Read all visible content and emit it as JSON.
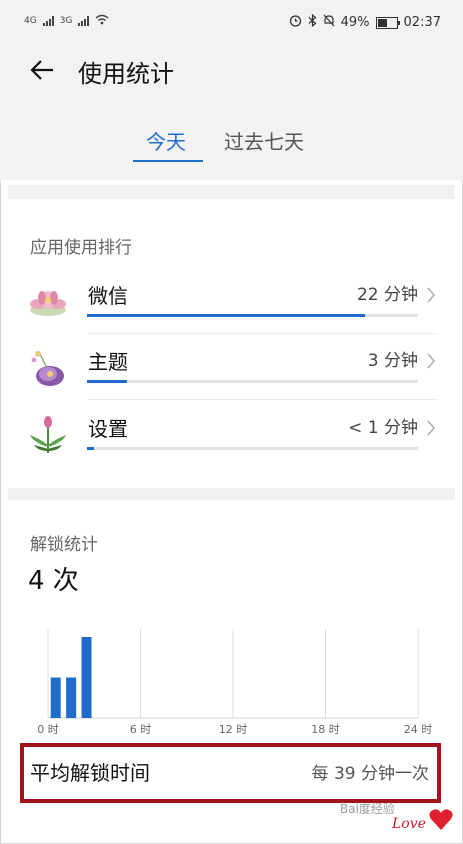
{
  "status_bar": {
    "net1": "4G",
    "net2": "3G",
    "battery": "49%",
    "time": "02:37"
  },
  "header": {
    "title": "使用统计",
    "tabs": [
      {
        "label": "今天",
        "active": true
      },
      {
        "label": "过去七天",
        "active": false
      }
    ]
  },
  "app_ranking": {
    "title": "应用使用排行",
    "items": [
      {
        "name": "微信",
        "time": "22 分钟",
        "usage_fraction": 0.84,
        "icon": "pink-flower-icon"
      },
      {
        "name": "主题",
        "time": "3 分钟",
        "usage_fraction": 0.12,
        "icon": "purple-flower-icon"
      },
      {
        "name": "设置",
        "time": "< 1 分钟",
        "usage_fraction": 0.02,
        "icon": "green-plant-icon"
      }
    ]
  },
  "unlock": {
    "title": "解锁统计",
    "count": "4 次",
    "chart_data": {
      "type": "bar",
      "x_ticks": [
        "0 时",
        "6 时",
        "12 时",
        "18 时",
        "24 时"
      ],
      "x_range": [
        0,
        24
      ],
      "y_range": [
        0,
        2
      ],
      "bars": [
        {
          "hour": 0,
          "value": 1
        },
        {
          "hour": 1,
          "value": 1
        },
        {
          "hour": 2,
          "value": 2
        }
      ],
      "grid": true,
      "color": "#1e6dcc"
    }
  },
  "average": {
    "label": "平均解锁时间",
    "value": "每 39 分钟一次"
  },
  "watermark": {
    "text1": "Bai度经验",
    "text2": "Love"
  },
  "colors": {
    "accent": "#1e6dcc",
    "highlight_border": "#a4141b"
  }
}
